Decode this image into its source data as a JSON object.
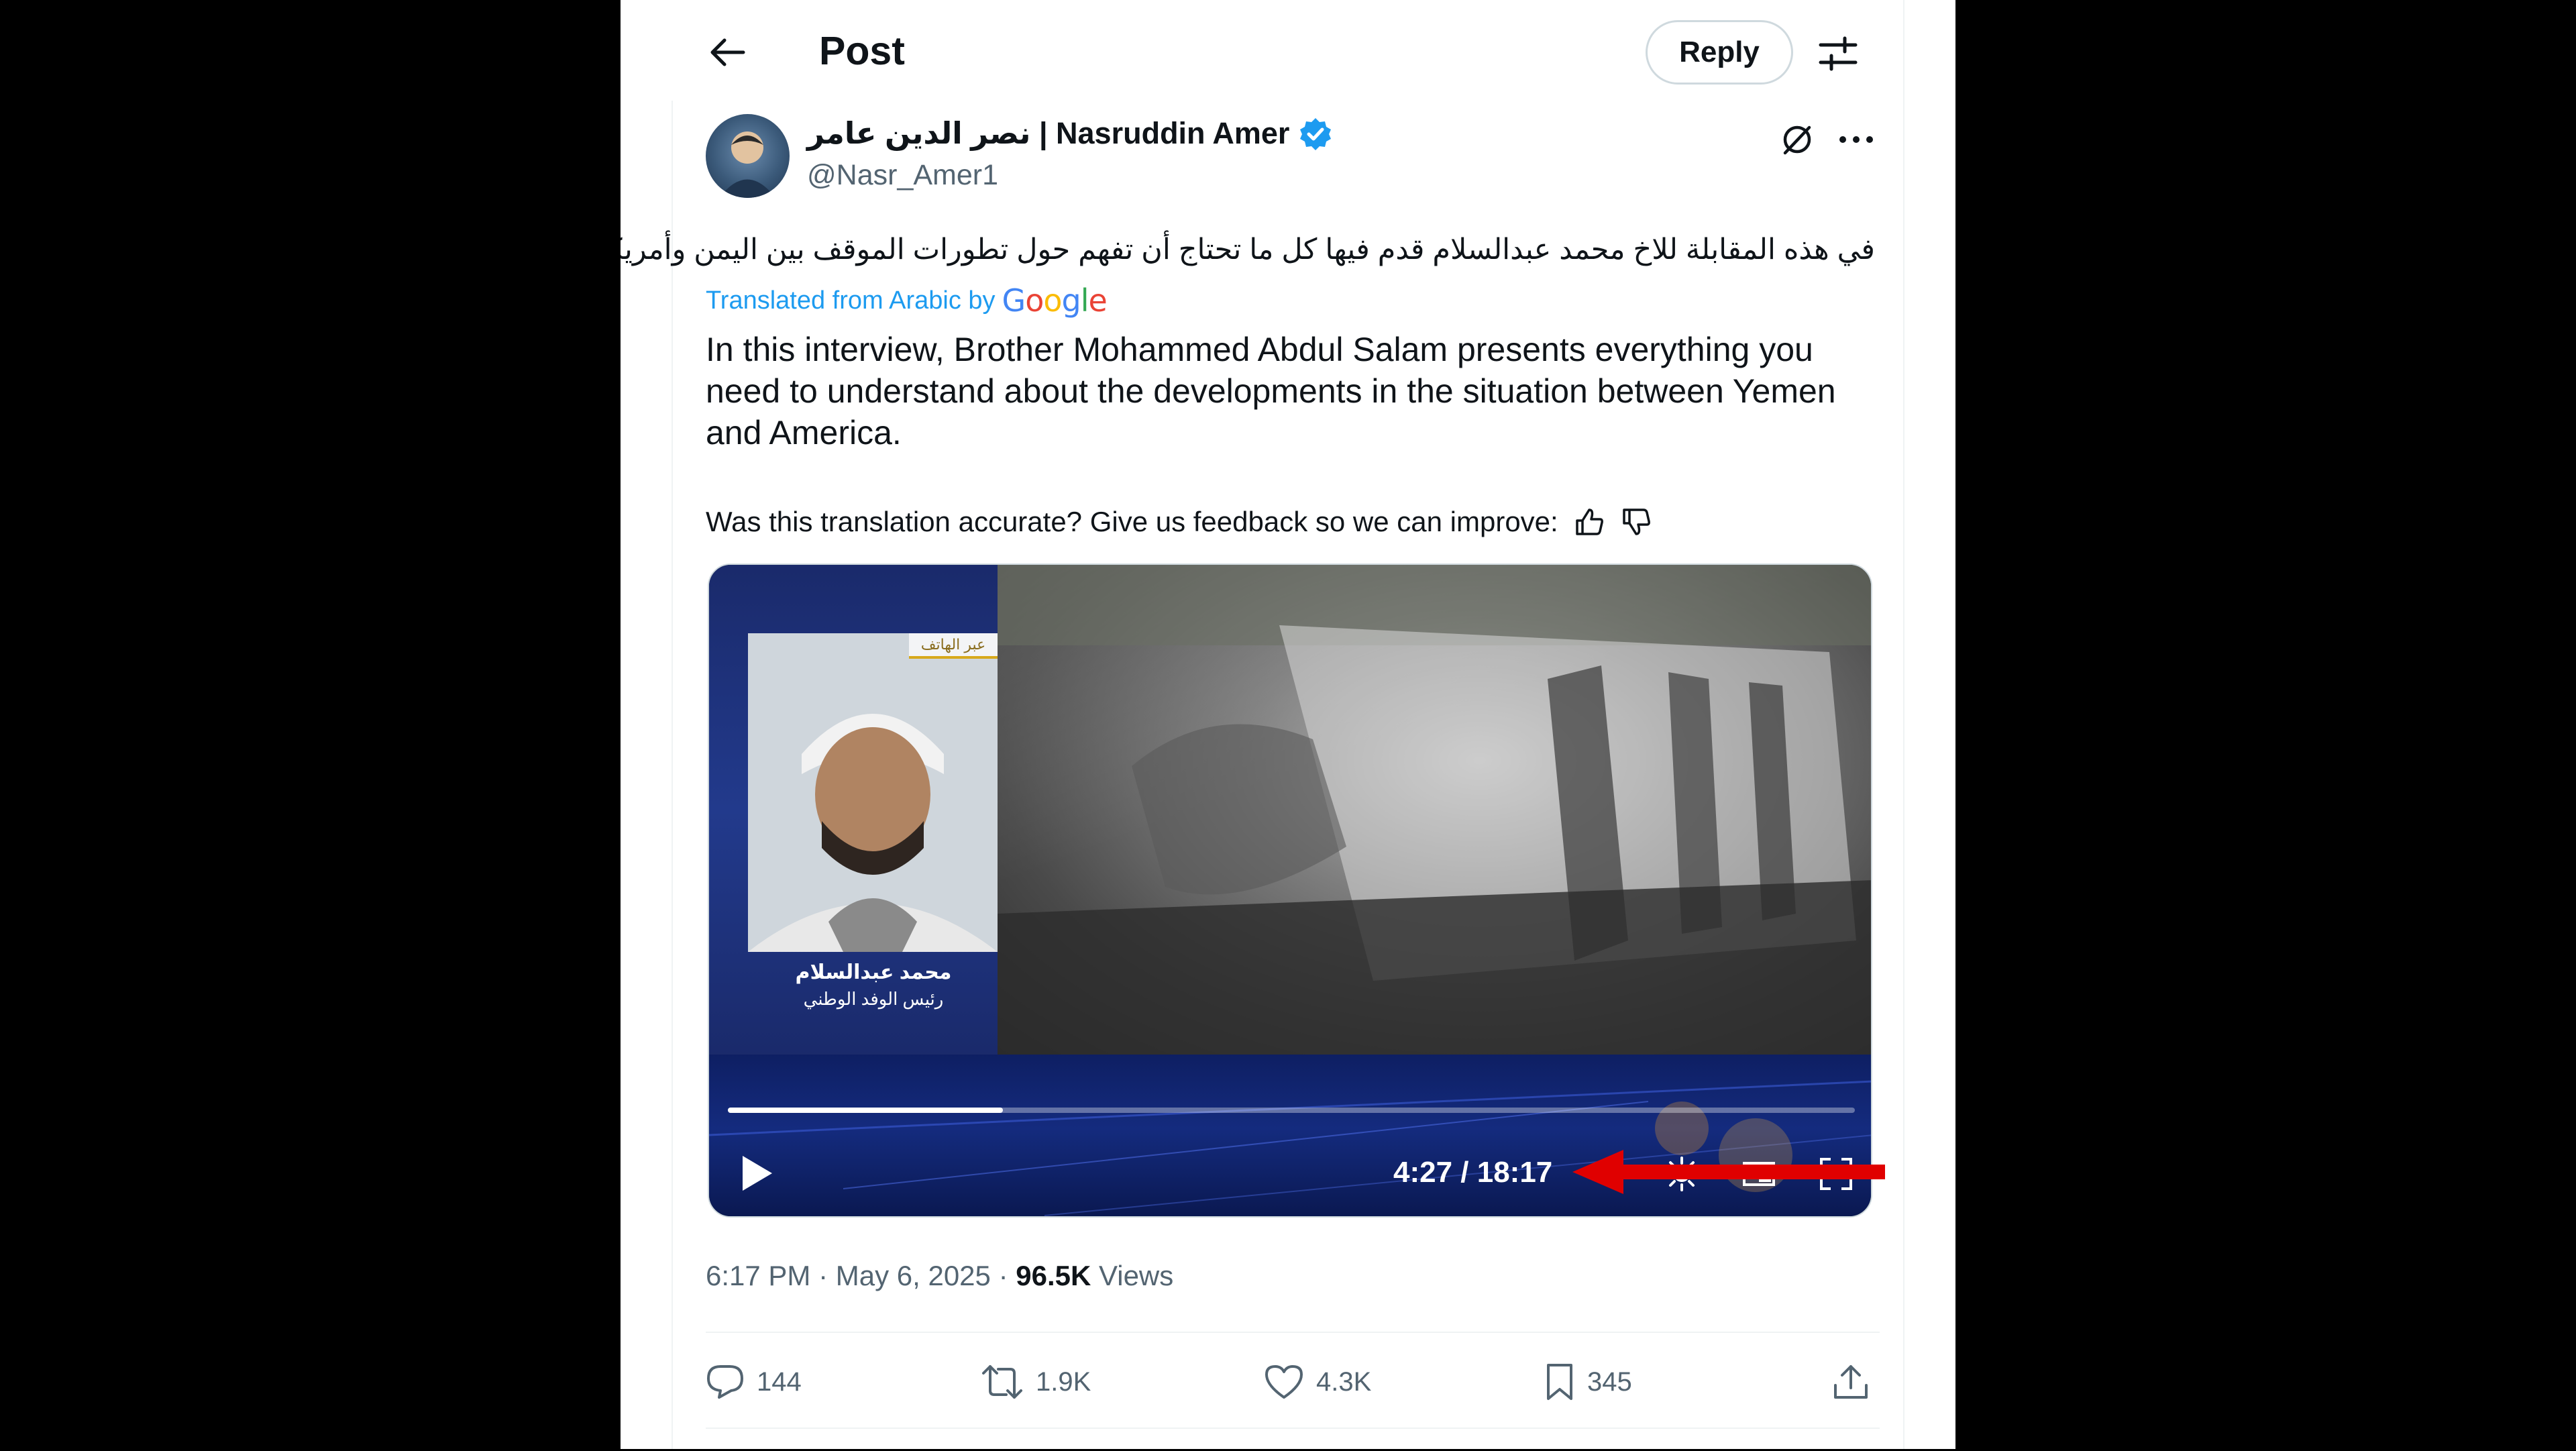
{
  "header": {
    "title": "Post",
    "reply_label": "Reply"
  },
  "author": {
    "display_name": "نصر الدين عامر | Nasruddin Amer",
    "handle": "@Nasr_Amer1",
    "verified": true
  },
  "post": {
    "original_text": "في هذه المقابلة للاخ محمد عبدالسلام قدم فيها كل ما تحتاج أن تفهم حول تطورات الموقف بين اليمن وأمريكا",
    "translated_from": "Translated from Arabic by",
    "translation_provider": "Google",
    "translated_text": "In this interview, Brother Mohammed Abdul Salam presents everything you need to understand about the developments in the situation between Yemen and America.",
    "feedback_prompt": "Was this translation accurate? Give us feedback so we can improve:"
  },
  "video": {
    "overlay_tag": "عبر الهاتف",
    "speaker_name": "محمد عبدالسلام",
    "speaker_role": "رئيس الوفد الوطني",
    "time_display": "4:27 / 18:17",
    "progress": 0.244
  },
  "meta": {
    "time": "6:17 PM",
    "separator": " · ",
    "date": "May 6, 2025",
    "views_count": "96.5K",
    "views_label": "Views"
  },
  "actions": {
    "replies": "144",
    "reposts": "1.9K",
    "likes": "4.3K",
    "bookmarks": "345"
  },
  "colors": {
    "accent": "#1d9bf0",
    "annotation_arrow": "#e00000",
    "secondary_text": "#536471"
  }
}
